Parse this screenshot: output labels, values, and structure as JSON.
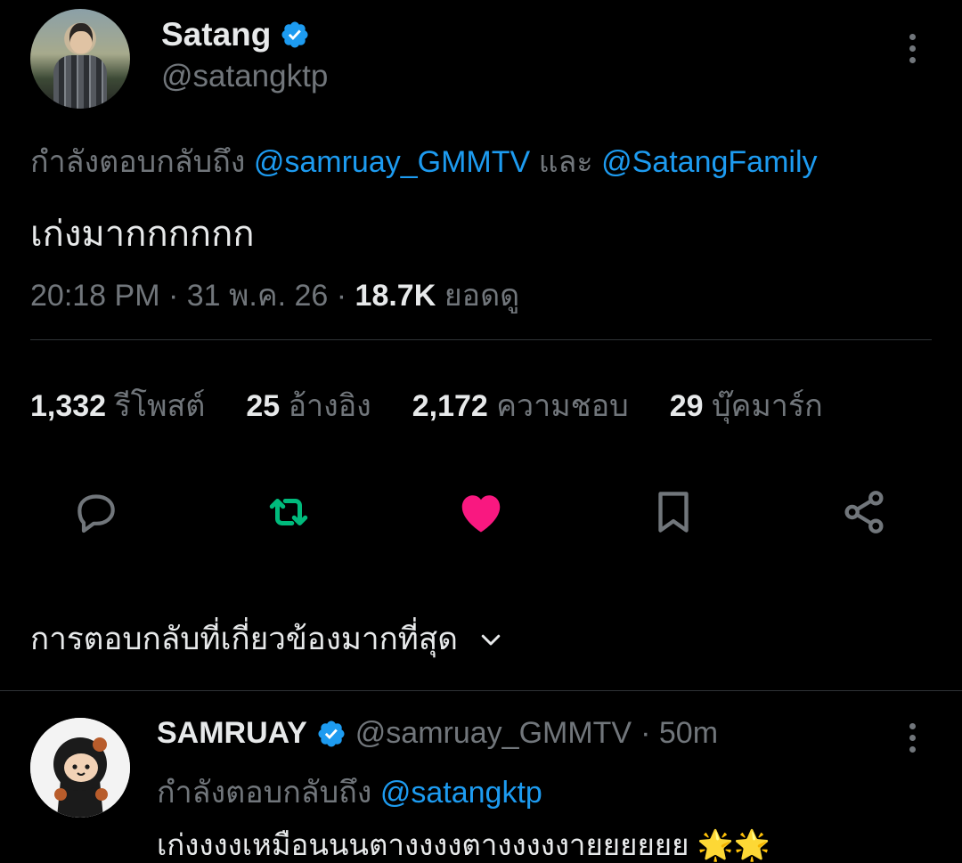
{
  "tweet": {
    "author": {
      "name": "Satang",
      "handle": "@satangktp"
    },
    "reply_context": {
      "prefix": "กำลังตอบกลับถึง",
      "mention1": "@samruay_GMMTV",
      "conj": "และ",
      "mention2": "@SatangFamily"
    },
    "text": "เก่งมากกกกกก",
    "meta": {
      "time_date": "20:18 PM · 31 พ.ค. 26 · ",
      "views": "18.7K",
      "views_label": " ยอดดู"
    },
    "stats": {
      "retweets": "1,332",
      "retweets_label": "รีโพสต์",
      "quotes": "25",
      "quotes_label": "อ้างอิง",
      "likes": "2,172",
      "likes_label": "ความชอบ",
      "bookmarks": "29",
      "bookmarks_label": "บุ๊คมาร์ก"
    },
    "colors": {
      "like": "#f91880",
      "retweet": "#00ba7c",
      "link": "#1d9bf0",
      "muted": "#71767b"
    }
  },
  "replies_sort": {
    "label": "การตอบกลับที่เกี่ยวข้องมากที่สุด"
  },
  "reply": {
    "author": {
      "name": "SAMRUAY",
      "handle": "@samruay_GMMTV",
      "time": "· 50m"
    },
    "reply_context": {
      "prefix": "กำลังตอบกลับถึง",
      "mention": "@satangktp"
    },
    "text": "เก่งงงงเหมือนนนตางงงงตางงงงงายยยยยย",
    "emoji": "🌟🌟"
  }
}
